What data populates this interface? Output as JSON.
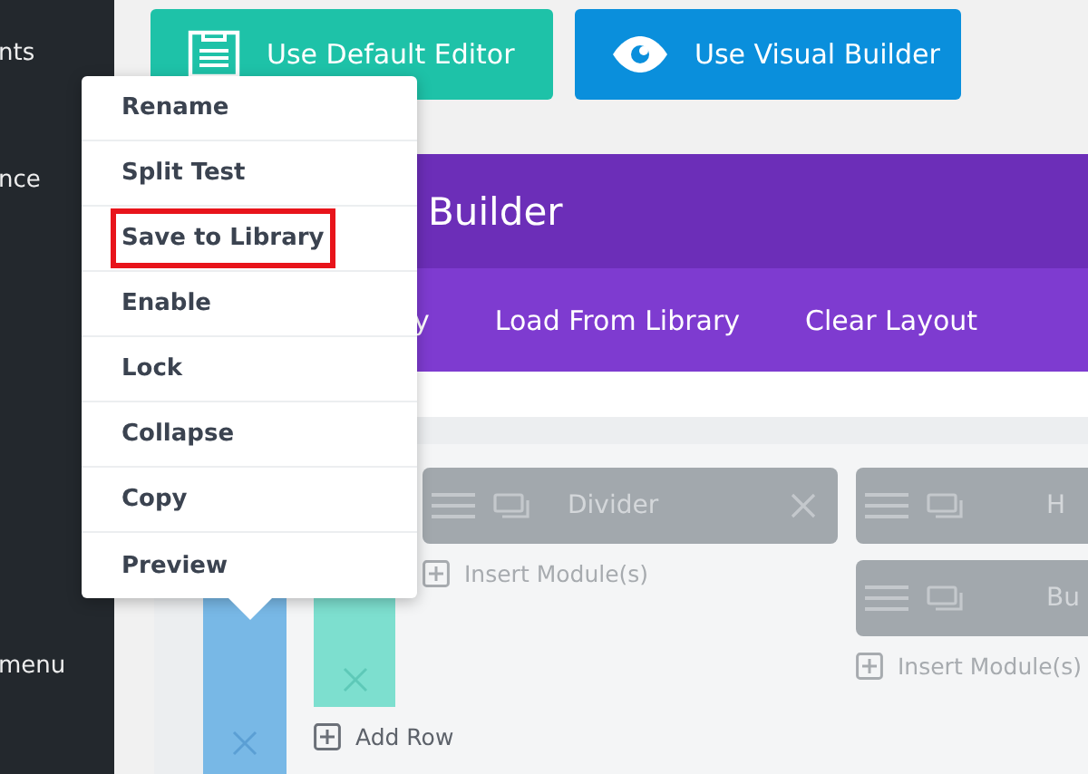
{
  "sidebar": {
    "items": [
      {
        "label": "nts"
      },
      {
        "label": "nce"
      },
      {
        "label": "menu"
      }
    ]
  },
  "editor_buttons": [
    {
      "label": "Use Default Editor",
      "kind": "default"
    },
    {
      "label": "Use Visual Builder",
      "kind": "visual"
    }
  ],
  "builder": {
    "title": "Builder",
    "toolbar": [
      "y",
      "Load From Library",
      "Clear Layout"
    ],
    "columns": [
      {
        "modules": [
          {
            "label": "Divider",
            "closable": true
          }
        ],
        "insert_label": "Insert Module(s)"
      },
      {
        "modules": [
          {
            "label": "H"
          },
          {
            "label": "Bu"
          }
        ],
        "insert_label": "Insert Module(s)"
      }
    ],
    "add_row": "Add Row"
  },
  "context_menu": {
    "items": [
      {
        "label": "Rename",
        "highlighted": false
      },
      {
        "label": "Split Test",
        "highlighted": false
      },
      {
        "label": "Save to Library",
        "highlighted": true
      },
      {
        "label": "Enable",
        "highlighted": false
      },
      {
        "label": "Lock",
        "highlighted": false
      },
      {
        "label": "Collapse",
        "highlighted": false
      },
      {
        "label": "Copy",
        "highlighted": false
      },
      {
        "label": "Preview",
        "highlighted": false
      }
    ]
  }
}
